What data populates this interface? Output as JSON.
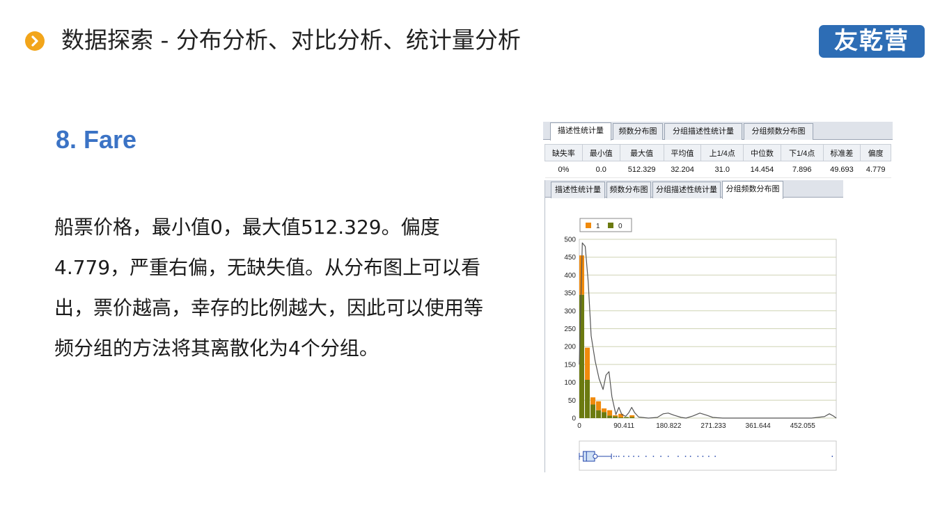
{
  "header": {
    "title": "数据探索 - 分布分析、对比分析、统计量分析",
    "logo_text": "友乾营",
    "accent_color": "#f2a51a",
    "logo_color": "#2d6db5"
  },
  "content": {
    "heading": "8. Fare",
    "paragraph": "船票价格，最小值0，最大值512.329。偏度4.779，严重右偏，无缺失值。从分布图上可以看出，票价越高，幸存的比例越大，因此可以使用等频分组的方法将其离散化为4个分组。"
  },
  "software": {
    "tabs_top": [
      "描述性统计量",
      "频数分布图",
      "分组描述性统计量",
      "分组频数分布图"
    ],
    "tabs_top_active": 0,
    "stats": {
      "headers": [
        "缺失率",
        "最小值",
        "最大值",
        "平均值",
        "上1/4点",
        "中位数",
        "下1/4点",
        "标准差",
        "偏度"
      ],
      "values": [
        "0%",
        "0.0",
        "512.329",
        "32.204",
        "31.0",
        "14.454",
        "7.896",
        "49.693",
        "4.779"
      ]
    },
    "tabs_bottom": [
      "描述性统计量",
      "频数分布图",
      "分组描述性统计量",
      "分组频数分布图"
    ],
    "tabs_bottom_active": 3
  },
  "chart_data": {
    "type": "bar",
    "stacked": true,
    "series": [
      {
        "name": "1",
        "color": "#f08a0c",
        "values": [
          110,
          90,
          20,
          25,
          10,
          15,
          3,
          10,
          0,
          5,
          0,
          0,
          0,
          0,
          0,
          0,
          0,
          0
        ]
      },
      {
        "name": "0",
        "color": "#6b7a10",
        "values": [
          345,
          107,
          38,
          22,
          17,
          7,
          5,
          2,
          3,
          3,
          0,
          0,
          0,
          0,
          0,
          0,
          0,
          0
        ]
      }
    ],
    "bin_width": 11.3,
    "x_ticks": [
      "0",
      "90.411",
      "180.822",
      "271.233",
      "361.644",
      "452.055"
    ],
    "x_tick_values": [
      0,
      90.411,
      180.822,
      271.233,
      361.644,
      452.055
    ],
    "xlim": [
      0,
      520
    ],
    "y_ticks": [
      "0",
      "50",
      "100",
      "150",
      "200",
      "250",
      "300",
      "350",
      "400",
      "450",
      "500"
    ],
    "ylim": [
      0,
      500
    ],
    "density_curve": [
      [
        0,
        150
      ],
      [
        6,
        490
      ],
      [
        12,
        480
      ],
      [
        18,
        380
      ],
      [
        24,
        230
      ],
      [
        32,
        160
      ],
      [
        40,
        110
      ],
      [
        48,
        80
      ],
      [
        54,
        120
      ],
      [
        60,
        130
      ],
      [
        66,
        60
      ],
      [
        74,
        10
      ],
      [
        80,
        30
      ],
      [
        86,
        10
      ],
      [
        94,
        5
      ],
      [
        100,
        15
      ],
      [
        106,
        30
      ],
      [
        112,
        15
      ],
      [
        120,
        3
      ],
      [
        140,
        0
      ],
      [
        158,
        2
      ],
      [
        170,
        12
      ],
      [
        180,
        14
      ],
      [
        192,
        8
      ],
      [
        206,
        2
      ],
      [
        216,
        0
      ],
      [
        230,
        6
      ],
      [
        244,
        14
      ],
      [
        258,
        8
      ],
      [
        270,
        2
      ],
      [
        290,
        0
      ],
      [
        340,
        0
      ],
      [
        420,
        0
      ],
      [
        470,
        0
      ],
      [
        496,
        4
      ],
      [
        506,
        12
      ],
      [
        514,
        6
      ],
      [
        520,
        0
      ]
    ],
    "legend_position": "top-left",
    "grid": true,
    "boxplot": {
      "whisker_low": 0,
      "q1": 7.896,
      "median": 14.454,
      "q3": 31.0,
      "whisker_high": 65
    }
  }
}
